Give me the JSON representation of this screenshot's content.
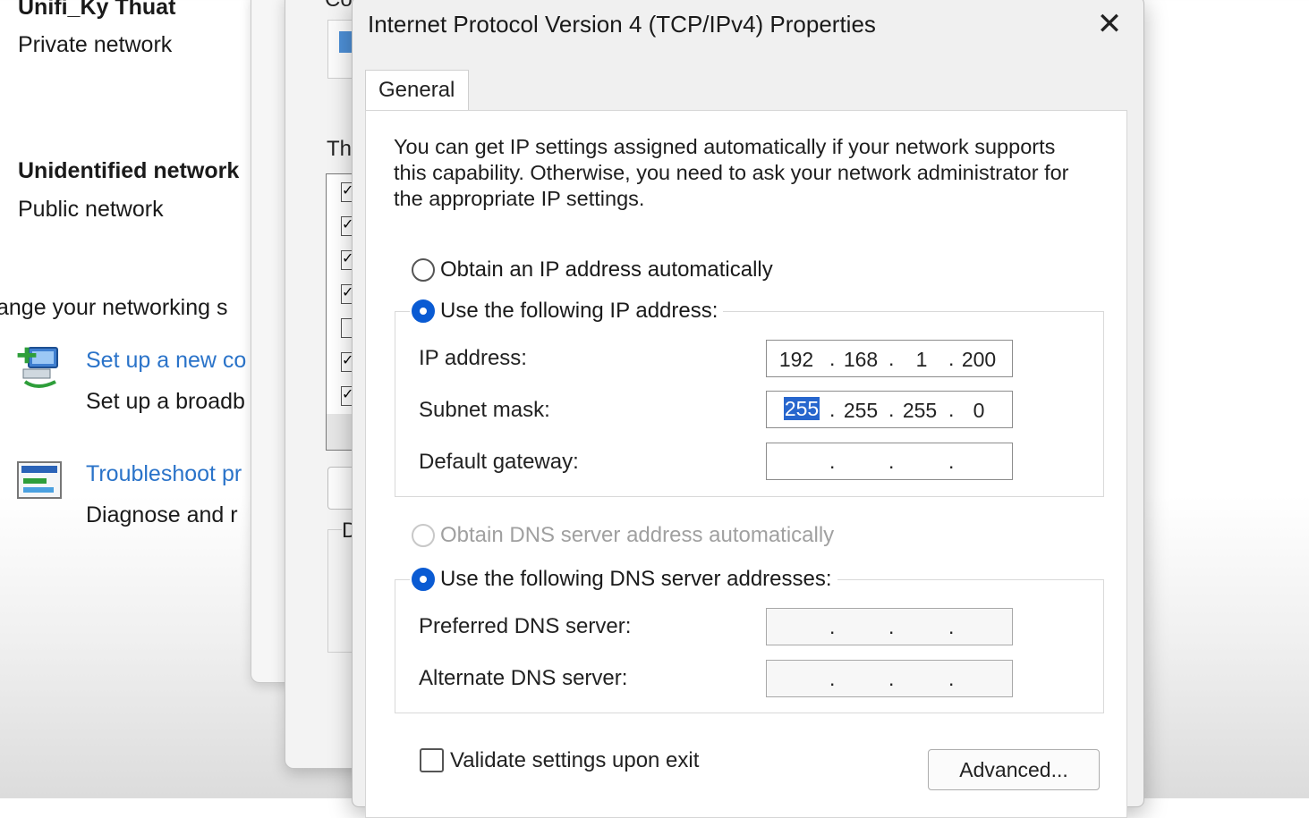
{
  "background": {
    "network1": {
      "name": "Unifi_Ky Thuat",
      "type": "Private network"
    },
    "network2": {
      "name": "Unidentified network",
      "type": "Public network"
    },
    "change_settings": "ange your networking s",
    "tasks": [
      {
        "title": "Set up a new co",
        "subtitle": "Set up a broadb"
      },
      {
        "title": "Troubleshoot pr",
        "subtitle": "Diagnose and r"
      }
    ],
    "window3": {
      "top_text": "Co",
      "this_text": "Thi",
      "d_text": "D"
    }
  },
  "dialog": {
    "title": "Internet Protocol Version 4 (TCP/IPv4) Properties",
    "close_glyph": "✕",
    "tab": "General",
    "description": "You can get IP settings assigned automatically if your network supports this capability. Otherwise, you need to ask your network administrator for the appropriate IP settings.",
    "ip_auto_label": "Obtain an IP address automatically",
    "ip_manual_label": "Use the following IP address:",
    "ip_address_label": "IP address:",
    "ip_address": [
      "192",
      "168",
      "1",
      "200"
    ],
    "subnet_label": "Subnet mask:",
    "subnet": [
      "255",
      "255",
      "255",
      "0"
    ],
    "gateway_label": "Default gateway:",
    "gateway": [
      "",
      "",
      "",
      ""
    ],
    "dns_auto_label": "Obtain DNS server address automatically",
    "dns_manual_label": "Use the following DNS server addresses:",
    "preferred_dns_label": "Preferred DNS server:",
    "alternate_dns_label": "Alternate DNS server:",
    "validate_label": "Validate settings upon exit",
    "advanced_label": "Advanced..."
  },
  "colors": {
    "accent": "#0a5bd3",
    "link": "#2a73c9",
    "selection": "#2766cd"
  }
}
